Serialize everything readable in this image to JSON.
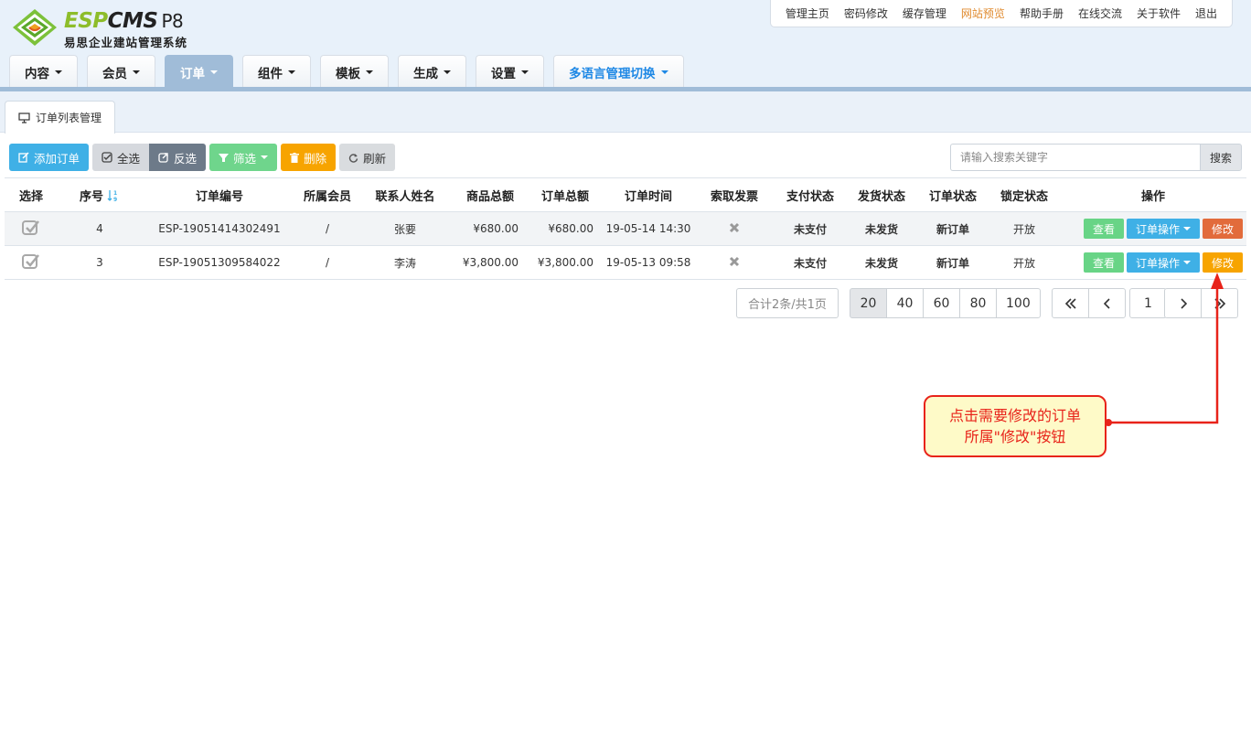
{
  "logo": {
    "brand_esp": "ESP",
    "brand_cms": "CMS",
    "brand_version": "P8",
    "subtitle": "易思企业建站管理系统"
  },
  "toplinks": [
    "管理主页",
    "密码修改",
    "缓存管理",
    "网站预览",
    "帮助手册",
    "在线交流",
    "关于软件",
    "退出"
  ],
  "toplinks_highlight_index": 3,
  "nav": {
    "tabs": [
      {
        "label": "内容",
        "state": "normal"
      },
      {
        "label": "会员",
        "state": "normal"
      },
      {
        "label": "订单",
        "state": "active"
      },
      {
        "label": "组件",
        "state": "normal"
      },
      {
        "label": "模板",
        "state": "normal"
      },
      {
        "label": "生成",
        "state": "normal"
      },
      {
        "label": "设置",
        "state": "normal"
      },
      {
        "label": "多语言管理切换",
        "state": "lang"
      }
    ]
  },
  "subtab": {
    "label": "订单列表管理"
  },
  "toolbar": {
    "add": "添加订单",
    "select_all": "全选",
    "invert": "反选",
    "filter": "筛选",
    "delete": "删除",
    "refresh": "刷新"
  },
  "search": {
    "placeholder": "请输入搜索关键字",
    "button": "搜索"
  },
  "table": {
    "headers": [
      "选择",
      "序号",
      "订单编号",
      "所属会员",
      "联系人姓名",
      "商品总额",
      "订单总额",
      "订单时间",
      "索取发票",
      "支付状态",
      "发货状态",
      "订单状态",
      "锁定状态",
      "操作"
    ],
    "rows": [
      {
        "seq": "4",
        "order_no": "ESP-19051414302491",
        "member": "/",
        "contact": "张要",
        "goods_total": "¥680.00",
        "order_total": "¥680.00",
        "time": "19-05-14 14:30",
        "pay": "未支付",
        "ship": "未发货",
        "status": "新订单",
        "lock": "开放"
      },
      {
        "seq": "3",
        "order_no": "ESP-19051309584022",
        "member": "/",
        "contact": "李涛",
        "goods_total": "¥3,800.00",
        "order_total": "¥3,800.00",
        "time": "19-05-13 09:58",
        "pay": "未支付",
        "ship": "未发货",
        "status": "新订单",
        "lock": "开放"
      }
    ],
    "row_actions": {
      "view": "查看",
      "operate": "订单操作",
      "edit": "修改"
    }
  },
  "pagination": {
    "info": "合计2条/共1页",
    "page_sizes": [
      "20",
      "40",
      "60",
      "80",
      "100"
    ],
    "active_size": "20",
    "current_page": "1"
  },
  "callout": {
    "line1": "点击需要修改的订单",
    "line2": "所属\"修改\"按钮"
  },
  "colors": {
    "accent_blue": "#3fb0e6",
    "nav_active": "#a0bcd8",
    "status_red": "#e5532d",
    "status_green": "#6cc06c",
    "callout_red": "#e8231a"
  }
}
